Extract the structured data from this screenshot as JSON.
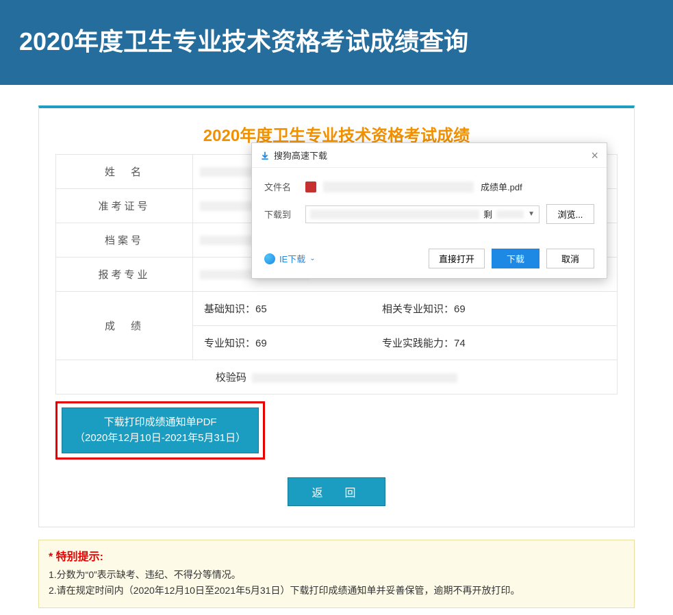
{
  "banner": {
    "title": "2020年度卫生专业技术资格考试成绩查询"
  },
  "card": {
    "title": "2020年度卫生专业技术资格考试成绩",
    "labels": {
      "name": "姓　名",
      "ticket": "准考证号",
      "file_no": "档案号",
      "major": "报考专业",
      "score": "成　绩",
      "check": "校验码"
    },
    "scores": {
      "basic_label": "基础知识：",
      "basic_value": "65",
      "related_label": "相关专业知识：",
      "related_value": "69",
      "pro_label": "专业知识：",
      "pro_value": "69",
      "practice_label": "专业实践能力：",
      "practice_value": "74"
    },
    "pdf_btn_line1": "下载打印成绩通知单PDF",
    "pdf_btn_line2": "（2020年12月10日-2021年5月31日）",
    "back_btn": "返　回"
  },
  "notice": {
    "head": "* 特别提示:",
    "line1": "1.分数为“0”表示缺考、违纪、不得分等情况。",
    "line2": "2.请在规定时间内（2020年12月10日至2021年5月31日）下载打印成绩通知单并妥善保管，逾期不再开放打印。"
  },
  "dialog": {
    "title": "搜狗高速下载",
    "filename_label": "文件名",
    "filename_suffix": "成绩单.pdf",
    "downloadto_label": "下载到",
    "remaining_prefix": "剩",
    "browse": "浏览...",
    "ie_download": "IE下载",
    "open_direct": "直接打开",
    "download": "下载",
    "cancel": "取消"
  }
}
